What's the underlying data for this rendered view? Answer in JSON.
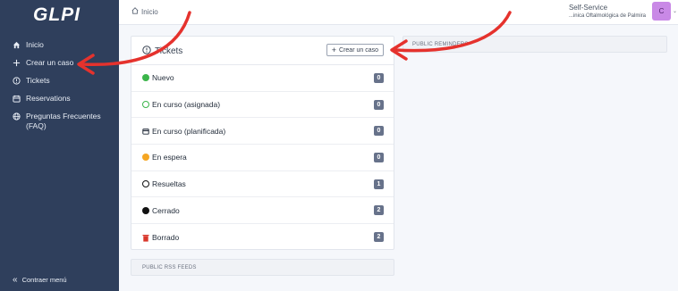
{
  "sidebar": {
    "logo": "GLPI",
    "items": [
      {
        "label": "Inicio",
        "icon": "home-icon"
      },
      {
        "label": "Crear un caso",
        "icon": "plus-icon"
      },
      {
        "label": "Tickets",
        "icon": "alert-circle-icon"
      },
      {
        "label": "Reservations",
        "icon": "calendar-icon"
      },
      {
        "label": "Preguntas Frecuentes (FAQ)",
        "icon": "globe-icon"
      }
    ],
    "collapse_label": "Contraer menú"
  },
  "header": {
    "breadcrumb": "Inicio",
    "role": "Self-Service",
    "entity": "...inica Oftalmológica de Palmira",
    "avatar_initial": "C",
    "avatar_color": "#c989e6"
  },
  "tickets": {
    "title": "Tickets",
    "new_button": "Crear un caso",
    "rows": [
      {
        "label": "Nuevo",
        "count": "0",
        "icon": "green-dot-icon",
        "color": "#3bb54a"
      },
      {
        "label": "En curso (asignada)",
        "count": "0",
        "icon": "green-ring-icon",
        "color": "#3bb54a"
      },
      {
        "label": "En curso (planificada)",
        "count": "0",
        "icon": "calendar-icon",
        "color": "#1f2937"
      },
      {
        "label": "En espera",
        "count": "0",
        "icon": "orange-dot-icon",
        "color": "#f5a623"
      },
      {
        "label": "Resueltas",
        "count": "1",
        "icon": "black-ring-icon",
        "color": "#111111"
      },
      {
        "label": "Cerrado",
        "count": "2",
        "icon": "black-dot-icon",
        "color": "#111111"
      },
      {
        "label": "Borrado",
        "count": "2",
        "icon": "trash-icon",
        "color": "#d9372b"
      }
    ]
  },
  "panels": {
    "rss": "PUBLIC RSS FEEDS",
    "reminders": "PUBLIC REMINDERS"
  },
  "annotations": {
    "arrow_color": "#e5322d"
  }
}
